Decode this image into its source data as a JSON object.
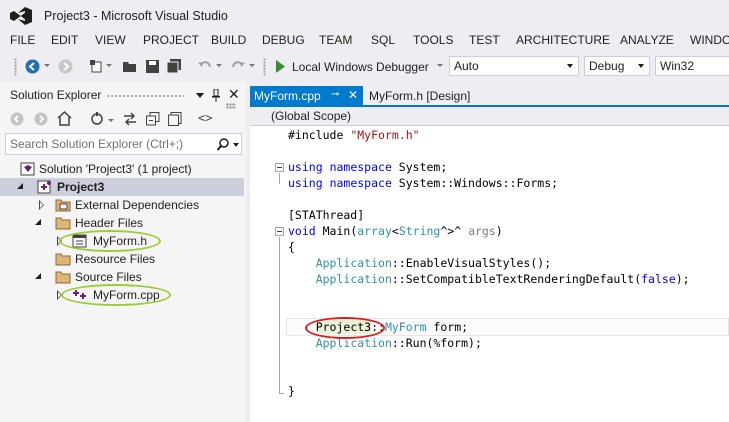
{
  "window": {
    "title": "Project3 - Microsoft Visual Studio"
  },
  "menu": [
    "FILE",
    "EDIT",
    "VIEW",
    "PROJECT",
    "BUILD",
    "DEBUG",
    "TEAM",
    "SQL",
    "TOOLS",
    "TEST",
    "ARCHITECTURE",
    "ANALYZE",
    "WINDO"
  ],
  "toolbar": {
    "debugger_label": "Local Windows Debugger",
    "solution_platform": "Auto",
    "configuration": "Debug",
    "platform": "Win32"
  },
  "solution_explorer": {
    "title": "Solution Explorer",
    "search_placeholder": "Search Solution Explorer (Ctrl+;)",
    "items": [
      {
        "label": "Solution 'Project3' (1 project)",
        "icon": "solution-icon"
      },
      {
        "label": "Project3",
        "icon": "project-icon"
      },
      {
        "label": "External Dependencies",
        "icon": "references-icon"
      },
      {
        "label": "Header Files",
        "icon": "folder-icon"
      },
      {
        "label": "MyForm.h",
        "icon": "form-header-icon"
      },
      {
        "label": "Resource Files",
        "icon": "folder-icon"
      },
      {
        "label": "Source Files",
        "icon": "folder-icon"
      },
      {
        "label": "MyForm.cpp",
        "icon": "cpp-file-icon"
      }
    ]
  },
  "editor": {
    "tabs": [
      {
        "label": "MyForm.cpp",
        "active": true
      },
      {
        "label": "MyForm.h [Design]",
        "active": false
      }
    ],
    "scope": "(Global Scope)"
  },
  "code": {
    "l1_pre": "#include ",
    "l1_str": "\"MyForm.h\"",
    "l2_kw1": "using",
    "l2_kw2": "namespace",
    "l2_rest": " System;",
    "l3_kw1": "using",
    "l3_kw2": "namespace",
    "l3_rest": " System::Windows::Forms;",
    "l4": "[STAThread]",
    "l5_kw": "void",
    "l5_a": " Main(",
    "l5_t1": "array",
    "l5_b": "<",
    "l5_t2": "String",
    "l5_c": "^>^ ",
    "l5_p": "args",
    "l5_d": ")",
    "l6": "{",
    "l7_t": "Application",
    "l7_rest": "::EnableVisualStyles();",
    "l8_t": "Application",
    "l8_a": "::SetCompatibleTextRenderingDefault(",
    "l8_kw": "false",
    "l8_b": ");",
    "l9_ns": "Project3",
    "l9_sep": "::",
    "l9_t": "MyForm",
    "l9_rest": " form;",
    "l10_t": "Application",
    "l10_rest": "::Run(%form);",
    "l11": "}"
  },
  "colors": {
    "accent": "#007ACC",
    "keyword": "#0000FF",
    "string": "#A31515",
    "type": "#2B91AF",
    "annotation_green": "#9ACD32",
    "annotation_red": "#E31B1B"
  }
}
